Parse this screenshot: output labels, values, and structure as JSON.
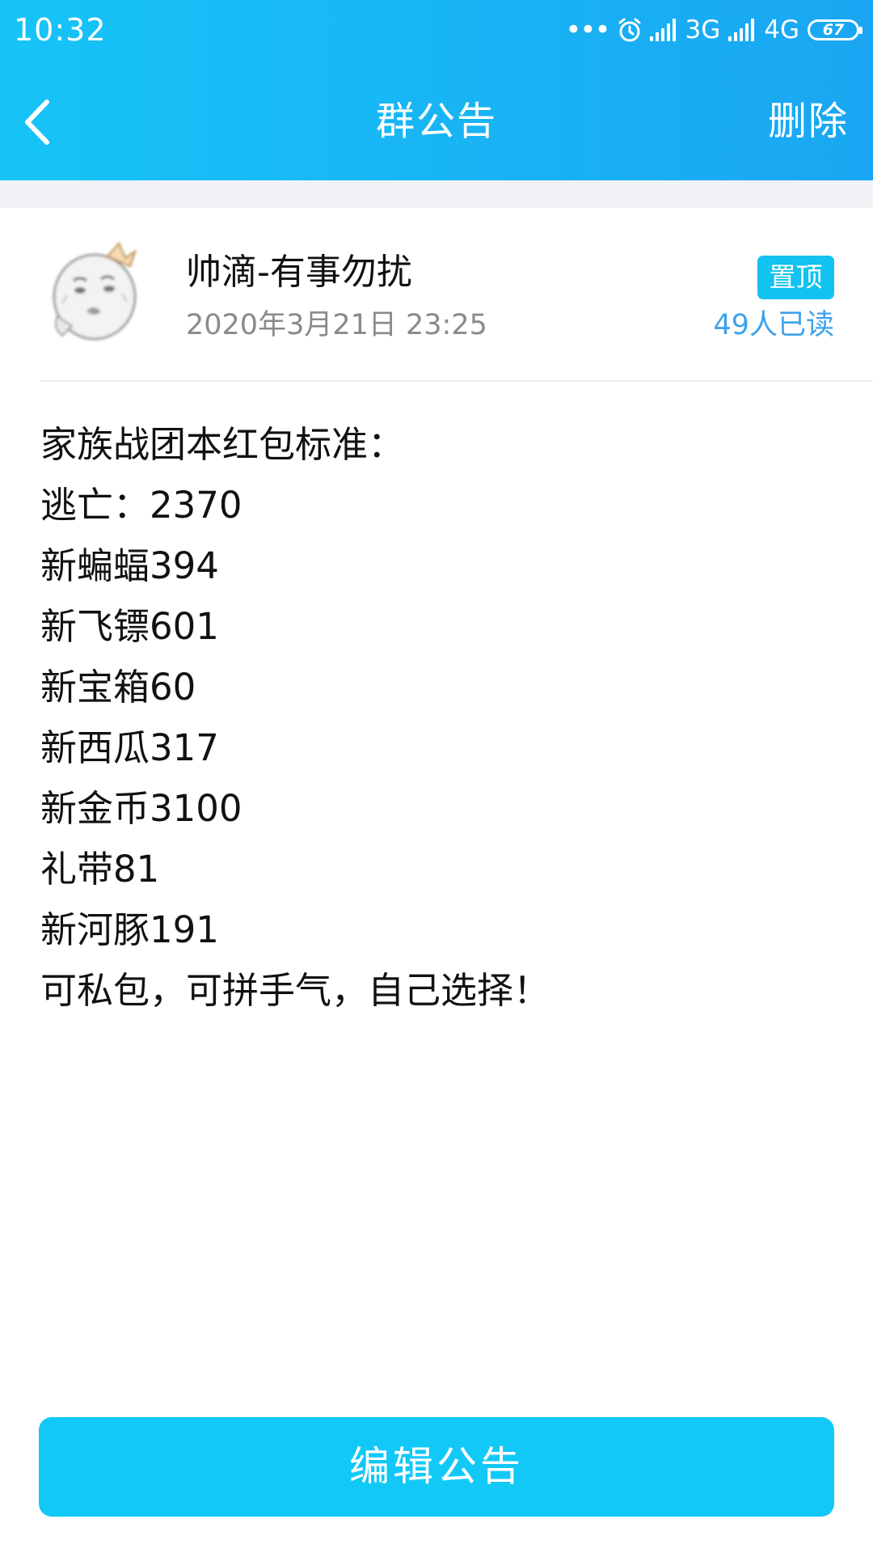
{
  "status_bar": {
    "time": "10:32",
    "dots": "•••",
    "network_1": "3G",
    "network_2": "4G",
    "battery": "67"
  },
  "nav": {
    "title": "群公告",
    "delete_label": "删除",
    "back_icon": "chevron-left-icon"
  },
  "announcement": {
    "author": "帅滴-有事勿扰",
    "time": "2020年3月21日 23:25",
    "pin_label": "置顶",
    "read_count": "49人已读",
    "lines": [
      "家族战团本红包标准：",
      "逃亡：2370",
      "新蝙蝠394",
      "新飞镖601",
      "新宝箱60",
      "新西瓜317",
      "新金币3100",
      "礼带81",
      "新河豚191",
      "可私包，可拼手气，自己选择！"
    ]
  },
  "footer": {
    "edit_label": "编辑公告"
  },
  "colors": {
    "header_gradient_start": "#16c4f7",
    "header_gradient_end": "#1aa6f2",
    "accent": "#12c2f0",
    "read_count": "#3da2ea"
  }
}
